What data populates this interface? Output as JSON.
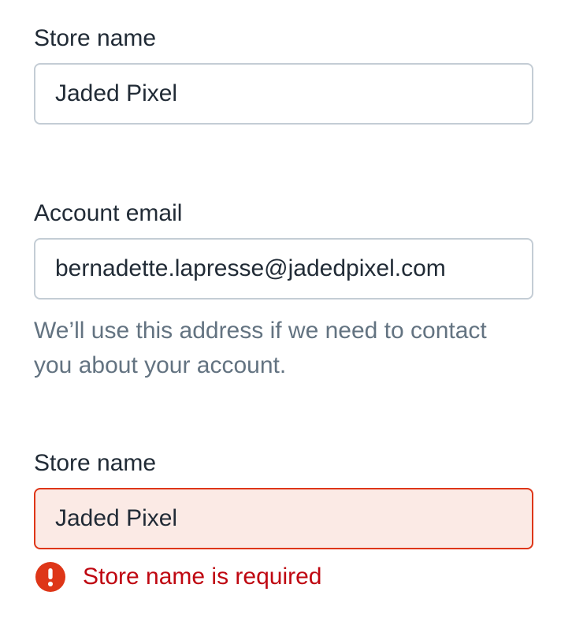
{
  "form": {
    "fields": [
      {
        "label": "Store name",
        "value": "Jaded Pixel"
      },
      {
        "label": "Account email",
        "value": "bernadette.lapresse@jadedpixel.com",
        "help_text": "We’ll use this address if we need to contact you about your account."
      },
      {
        "label": "Store name",
        "value": "Jaded Pixel",
        "state": "error",
        "error_message": "Store name is required",
        "error_icon": "alert-circle-icon"
      }
    ]
  },
  "colors": {
    "text": "#212b36",
    "help_text": "#637381",
    "border": "#c4cdd5",
    "error_border": "#de3618",
    "error_background": "#fbeae5",
    "error_text": "#bf0711"
  }
}
